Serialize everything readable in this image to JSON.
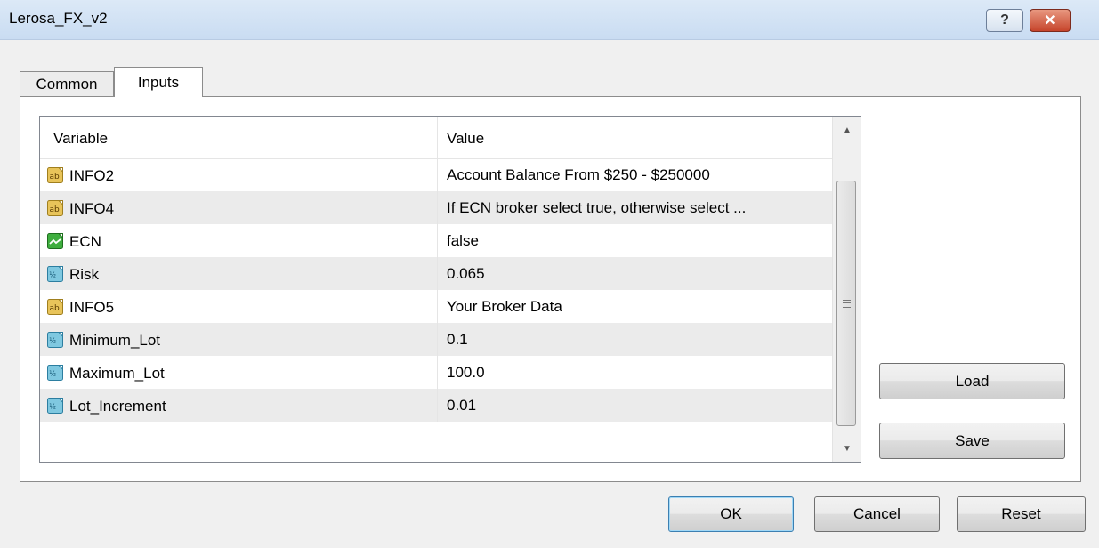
{
  "window": {
    "title": "Lerosa_FX_v2",
    "help_label": "?",
    "close_label": "✕"
  },
  "tabs": [
    {
      "label": "Common",
      "active": false
    },
    {
      "label": "Inputs",
      "active": true
    }
  ],
  "grid": {
    "headers": {
      "variable": "Variable",
      "value": "Value"
    },
    "rows": [
      {
        "icon": "string-type-icon",
        "name": "INFO2",
        "value": "Account Balance From $250 - $250000"
      },
      {
        "icon": "string-type-icon",
        "name": "INFO4",
        "value": "If ECN broker select true, otherwise select ..."
      },
      {
        "icon": "bool-type-icon",
        "name": "ECN",
        "value": "false"
      },
      {
        "icon": "double-type-icon",
        "name": "Risk",
        "value": "0.065"
      },
      {
        "icon": "string-type-icon",
        "name": "INFO5",
        "value": "Your Broker Data"
      },
      {
        "icon": "double-type-icon",
        "name": "Minimum_Lot",
        "value": "0.1"
      },
      {
        "icon": "double-type-icon",
        "name": "Maximum_Lot",
        "value": "100.0"
      },
      {
        "icon": "double-type-icon",
        "name": "Lot_Increment",
        "value": "0.01"
      }
    ]
  },
  "buttons": {
    "load": "Load",
    "save": "Save",
    "ok": "OK",
    "cancel": "Cancel",
    "reset": "Reset"
  },
  "colors": {
    "string_icon": "#e8c45a",
    "bool_icon": "#3fae3f",
    "double_icon": "#7fc8e0"
  }
}
